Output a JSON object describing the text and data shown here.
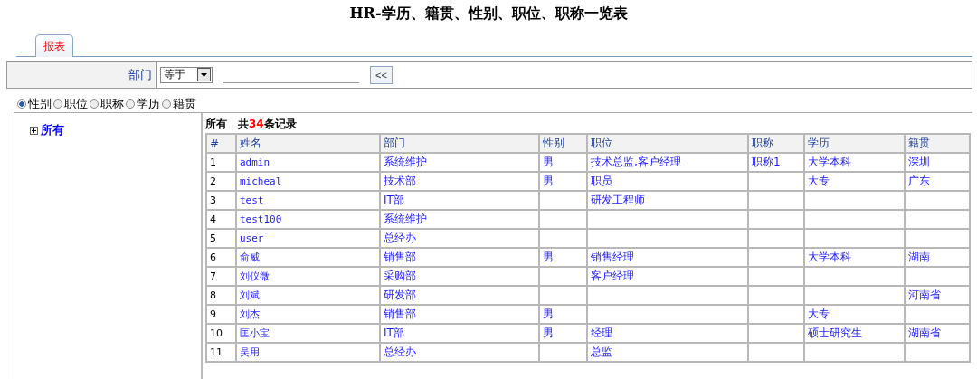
{
  "title": "HR-学历、籍贯、性别、职位、职称一览表",
  "tabs": [
    {
      "label": "报表",
      "selected": true
    }
  ],
  "filter": {
    "label": "部门",
    "operator": "等于",
    "button": "<<"
  },
  "group_by": [
    {
      "label": "性别",
      "selected": true
    },
    {
      "label": "职位",
      "selected": false
    },
    {
      "label": "职称",
      "selected": false
    },
    {
      "label": "学历",
      "selected": false
    },
    {
      "label": "籍贯",
      "selected": false
    }
  ],
  "tree": [
    {
      "label": "所有",
      "expanded": false
    }
  ],
  "summary": {
    "scope": "所有",
    "prefix": "共",
    "count": "34",
    "suffix": "条记录"
  },
  "table": {
    "columns": [
      "#",
      "姓名",
      "部门",
      "性别",
      "职位",
      "职称",
      "学历",
      "籍贯"
    ],
    "rows": [
      [
        "1",
        "admin",
        "系统维护",
        "男",
        "技术总监,客户经理",
        "职称1",
        "大学本科",
        "深圳"
      ],
      [
        "2",
        "micheal",
        "技术部",
        "男",
        "职员",
        null,
        "大专",
        "广东"
      ],
      [
        "3",
        "test",
        "IT部",
        null,
        "研发工程师",
        null,
        null,
        null
      ],
      [
        "4",
        "test100",
        "系统维护",
        null,
        null,
        null,
        null,
        null
      ],
      [
        "5",
        "user",
        "总经办",
        null,
        null,
        null,
        null,
        null
      ],
      [
        "6",
        "俞威",
        "销售部",
        "男",
        "销售经理",
        null,
        "大学本科",
        "湖南"
      ],
      [
        "7",
        "刘仪微",
        "采购部",
        null,
        "客户经理",
        null,
        null,
        null
      ],
      [
        "8",
        "刘斌",
        "研发部",
        null,
        null,
        null,
        null,
        "河南省"
      ],
      [
        "9",
        "刘杰",
        "销售部",
        "男",
        null,
        null,
        "大专",
        null
      ],
      [
        "10",
        "匡小宝",
        "IT部",
        "男",
        "经理",
        null,
        "硕士研究生",
        "湖南省"
      ],
      [
        "11",
        "吴用",
        "总经办",
        null,
        "总监",
        null,
        null,
        null
      ]
    ]
  }
}
